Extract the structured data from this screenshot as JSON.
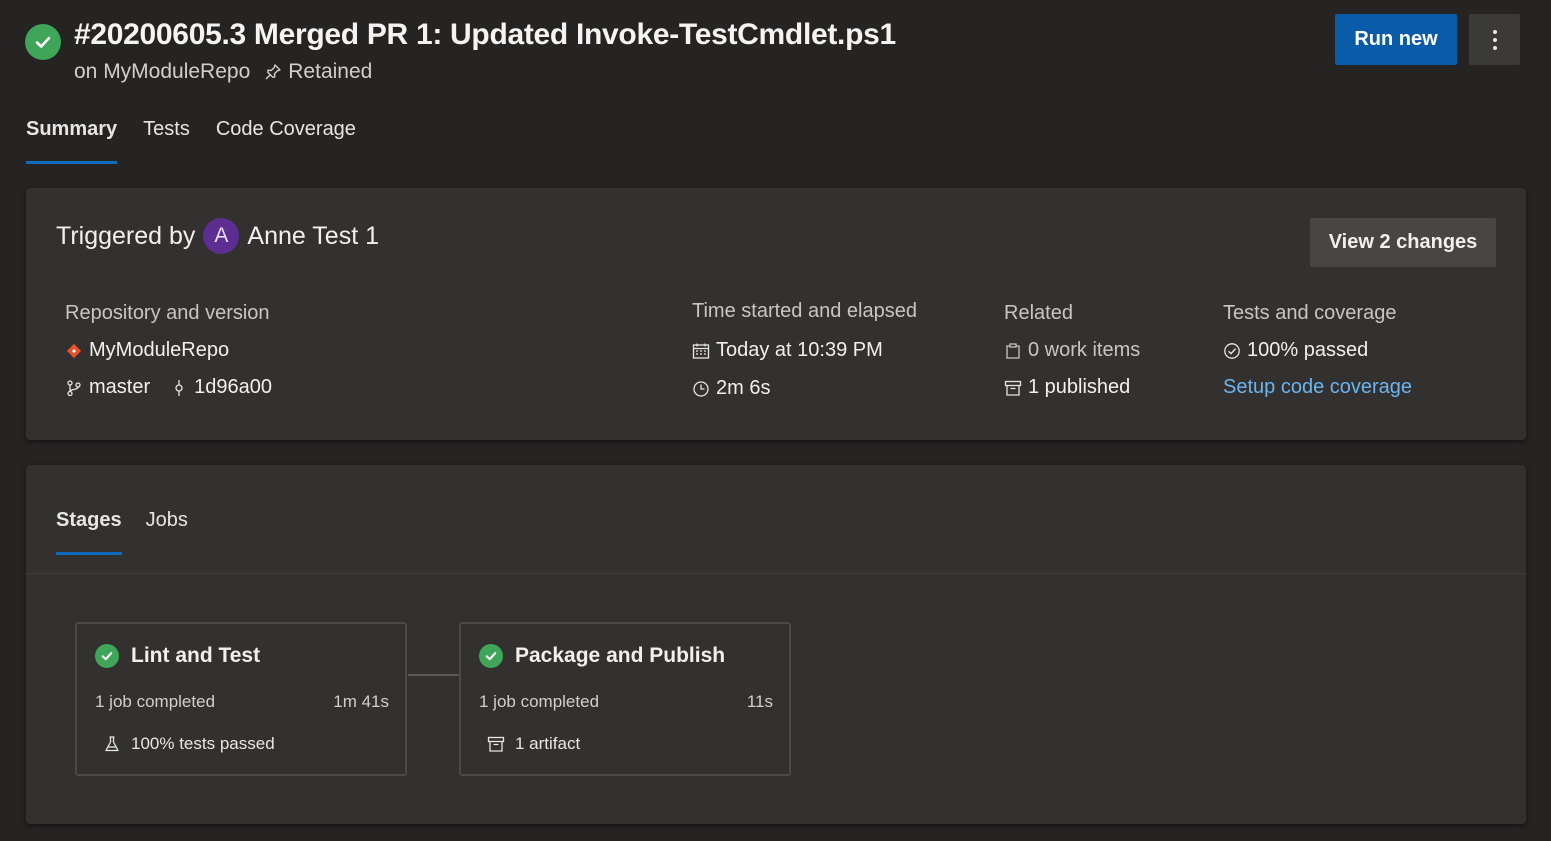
{
  "header": {
    "title": "#20200605.3 Merged PR 1: Updated Invoke-TestCmdlet.ps1",
    "repo_text": "on MyModuleRepo",
    "retained_text": "Retained",
    "run_new_label": "Run new",
    "status_icon": "check-circle-icon",
    "more_icon": "vertical-ellipsis-icon"
  },
  "tabs": [
    {
      "label": "Summary",
      "active": true
    },
    {
      "label": "Tests",
      "active": false
    },
    {
      "label": "Code Coverage",
      "active": false
    }
  ],
  "summary": {
    "triggered_by_label": "Triggered by",
    "avatar_letter": "A",
    "user_name": "Anne Test 1",
    "view_changes_label": "View 2 changes",
    "repository": {
      "heading": "Repository and version",
      "repo_name": "MyModuleRepo",
      "branch": "master",
      "commit": "1d96a00"
    },
    "time": {
      "heading": "Time started and elapsed",
      "started": "Today at 10:39 PM",
      "elapsed": "2m 6s"
    },
    "related": {
      "heading": "Related",
      "work_items": "0 work items",
      "published": "1 published"
    },
    "tests": {
      "heading": "Tests and coverage",
      "passed": "100% passed",
      "setup_link": "Setup code coverage"
    }
  },
  "stages_section": {
    "tabs": [
      {
        "label": "Stages",
        "active": true
      },
      {
        "label": "Jobs",
        "active": false
      }
    ],
    "stages": [
      {
        "name": "Lint and Test",
        "jobs": "1 job completed",
        "duration": "1m 41s",
        "extra": "100% tests passed",
        "extra_icon": "flask-icon"
      },
      {
        "name": "Package and Publish",
        "jobs": "1 job completed",
        "duration": "11s",
        "extra": "1 artifact",
        "extra_icon": "artifact-icon"
      }
    ]
  },
  "colors": {
    "background": "#252423",
    "card": "#323130",
    "accent": "#0f6cbd",
    "success": "#3fa659",
    "link": "#6bb4f0",
    "avatar": "#5c2e91"
  }
}
